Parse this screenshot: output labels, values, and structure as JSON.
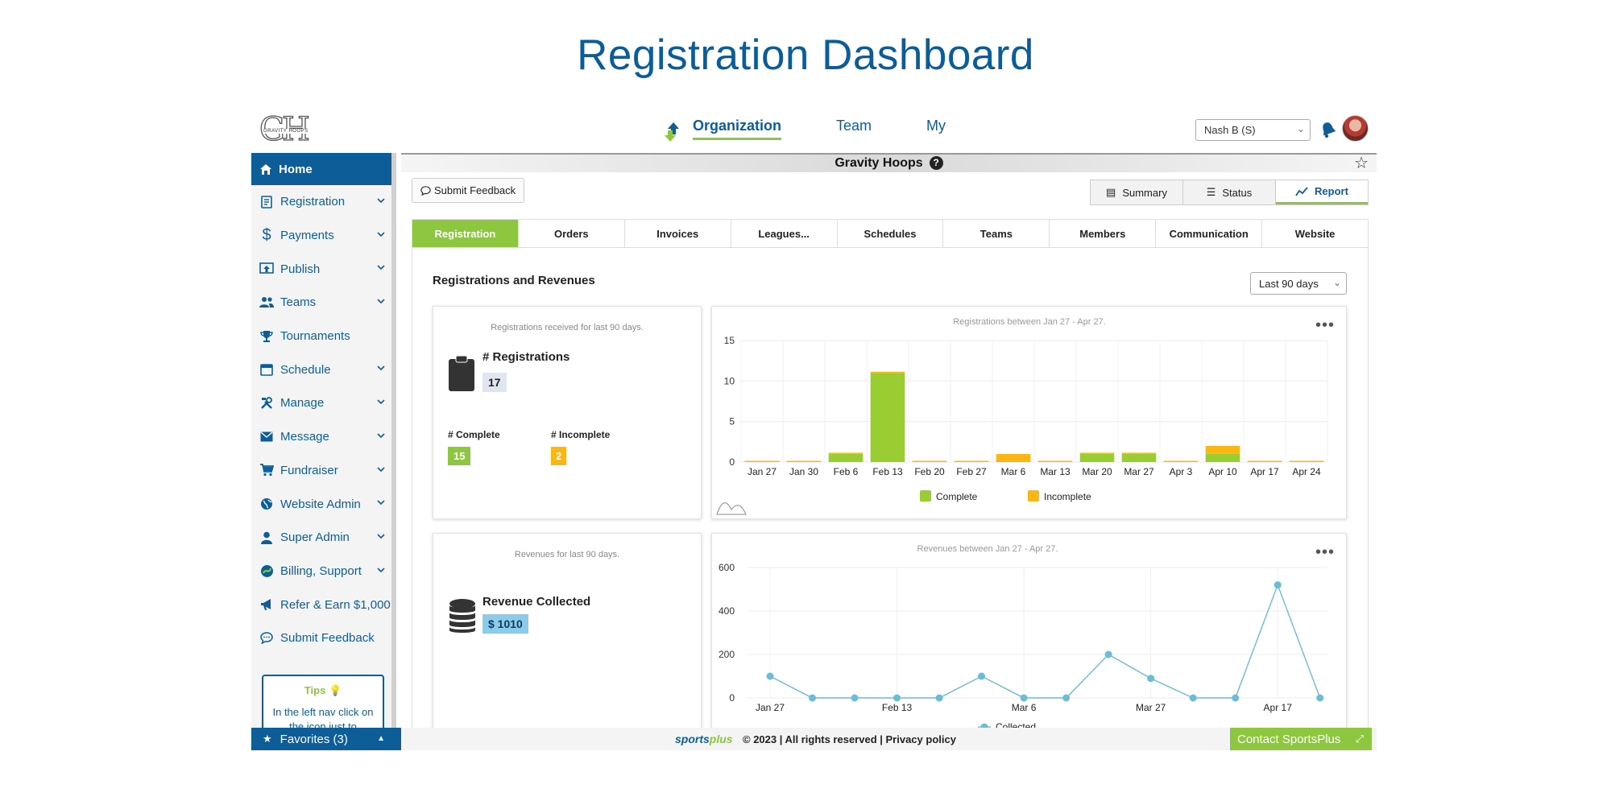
{
  "page": {
    "title": "Registration Dashboard"
  },
  "brand": {
    "logo_text": "GH",
    "logo_caption": "GRAVITY HOOPS",
    "accent": "#8dc63f",
    "primary": "#0d5e98"
  },
  "header": {
    "nav": [
      {
        "label": "Organization",
        "active": true
      },
      {
        "label": "Team",
        "active": false
      },
      {
        "label": "My",
        "active": false
      }
    ],
    "user_select": "Nash B (S)"
  },
  "sidebar": {
    "home": "Home",
    "items": [
      {
        "label": "Registration",
        "icon": "clipboard-icon",
        "expandable": true
      },
      {
        "label": "Payments",
        "icon": "dollar-icon",
        "expandable": true
      },
      {
        "label": "Publish",
        "icon": "publish-icon",
        "expandable": true
      },
      {
        "label": "Teams",
        "icon": "people-icon",
        "expandable": true
      },
      {
        "label": "Tournaments",
        "icon": "trophy-icon",
        "expandable": false
      },
      {
        "label": "Schedule",
        "icon": "calendar-icon",
        "expandable": true
      },
      {
        "label": "Manage",
        "icon": "tools-icon",
        "expandable": true
      },
      {
        "label": "Message",
        "icon": "envelope-icon",
        "expandable": true
      },
      {
        "label": "Fundraiser",
        "icon": "cart-icon",
        "expandable": true
      },
      {
        "label": "Website Admin",
        "icon": "globe-icon",
        "expandable": true
      },
      {
        "label": "Super Admin",
        "icon": "person-icon",
        "expandable": true
      },
      {
        "label": "Billing, Support",
        "icon": "billing-icon",
        "expandable": true
      },
      {
        "label": "Refer & Earn $1,000",
        "icon": "megaphone-icon",
        "expandable": false
      },
      {
        "label": "Submit Feedback",
        "icon": "chat-icon",
        "expandable": false
      }
    ],
    "tips": {
      "title": "Tips",
      "text": "In the left nav click on the icon just to"
    },
    "favorites": "Favorites (3)"
  },
  "main": {
    "org_name": "Gravity Hoops",
    "help": "?",
    "feedback_button": "Submit Feedback",
    "view_tabs": [
      {
        "label": "Summary",
        "active": false
      },
      {
        "label": "Status",
        "active": false
      },
      {
        "label": "Report",
        "active": true
      }
    ],
    "section_tabs": [
      {
        "label": "Registration",
        "active": true
      },
      {
        "label": "Orders",
        "active": false
      },
      {
        "label": "Invoices",
        "active": false
      },
      {
        "label": "Leagues...",
        "active": false
      },
      {
        "label": "Schedules",
        "active": false
      },
      {
        "label": "Teams",
        "active": false
      },
      {
        "label": "Members",
        "active": false
      },
      {
        "label": "Communication",
        "active": false
      },
      {
        "label": "Website",
        "active": false
      }
    ],
    "panel_title": "Registrations and Revenues",
    "range": "Last 90 days",
    "registrations_card": {
      "subtitle": "Registrations received for last 90 days.",
      "label": "# Registrations",
      "value": "17",
      "complete_label": "# Complete",
      "complete_value": "15",
      "incomplete_label": "# Incomplete",
      "incomplete_value": "2"
    },
    "revenue_card": {
      "subtitle": "Revenues for last 90 days.",
      "label": "Revenue Collected",
      "value": "$ 1010"
    }
  },
  "chart_data": [
    {
      "type": "bar",
      "title": "Registrations between Jan 27 - Apr 27.",
      "categories": [
        "Jan 27",
        "Jan 30",
        "Feb 6",
        "Feb 13",
        "Feb 20",
        "Feb 27",
        "Mar 6",
        "Mar 13",
        "Mar 20",
        "Mar 27",
        "Apr 3",
        "Apr 10",
        "Apr 17",
        "Apr 24"
      ],
      "series": [
        {
          "name": "Complete",
          "color": "#9acd32",
          "values": [
            0,
            0,
            1,
            11,
            0,
            0,
            0,
            0,
            1,
            1,
            0,
            1,
            0,
            0
          ]
        },
        {
          "name": "Incomplete",
          "color": "#fbb614",
          "values": [
            0,
            0,
            0,
            0,
            0,
            0,
            1,
            0,
            0,
            0,
            0,
            1,
            0,
            0
          ]
        }
      ],
      "yticks": [
        0,
        5,
        10,
        15
      ],
      "ylim": [
        0,
        15
      ],
      "stacked": true,
      "grid": true,
      "legend": "bottom"
    },
    {
      "type": "line",
      "title": "Revenues between Jan 27 - Apr 27.",
      "x": [
        "Jan 27",
        "Jan 30",
        "Feb 6",
        "Feb 13",
        "Feb 20",
        "Feb 27",
        "Mar 6",
        "Mar 13",
        "Mar 20",
        "Mar 27",
        "Apr 3",
        "Apr 10",
        "Apr 17",
        "Apr 24"
      ],
      "xtick_labels": [
        "Jan 27",
        "Feb 13",
        "Mar 6",
        "Mar 27",
        "Apr 17"
      ],
      "series": [
        {
          "name": "Collected",
          "color": "#6bbcd6",
          "values": [
            100,
            0,
            0,
            0,
            0,
            100,
            0,
            0,
            200,
            90,
            0,
            0,
            520,
            0
          ]
        }
      ],
      "yticks": [
        0,
        200,
        400,
        600
      ],
      "ylim": [
        0,
        600
      ],
      "grid": true,
      "legend": "bottom"
    }
  ],
  "footer": {
    "brand_part1": "sports",
    "brand_part2": "plus",
    "text": "© 2023 | All rights reserved | Privacy policy",
    "contact": "Contact SportsPlus"
  }
}
